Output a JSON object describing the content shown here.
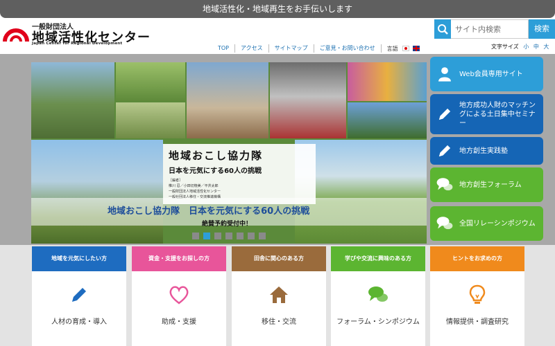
{
  "header": {
    "tagline": "地域活性化・地域再生をお手伝いします",
    "logo_small": "一般財団法人",
    "logo_main": "地域活性化センター",
    "logo_en": "Japan Center for Regional Development"
  },
  "search": {
    "placeholder": "サイト内検索",
    "button": "検索"
  },
  "nav": {
    "links": [
      "TOP",
      "アクセス",
      "サイトマップ",
      "ご意見・お問い合わせ"
    ],
    "lang_label": "言語",
    "fontsize_label": "文字サイズ",
    "fontsize_options": [
      "小",
      "中",
      "大"
    ]
  },
  "slideshow": {
    "book_title": "地域おこし協力隊",
    "book_subtitle": "日本を元気にする60人の挑戦",
    "book_meta": [
      "［編者］",
      "椎川 忍／小田切徳美／平井太郎",
      "一般財団法人地域活性化センター",
      "一般社団法人移住・交流推進機構"
    ],
    "caption": "地域おこし協力隊　日本を元気にする60人の挑戦",
    "subcaption": "絶賛予約受付中！",
    "dot_count": 7,
    "active_dot": 1
  },
  "sidenav": [
    {
      "label": "Web会員専用サイト",
      "icon": "person-icon",
      "color": "#2d9ed8"
    },
    {
      "label": "地方成功人財のマッチングによる土日集中セミナー",
      "icon": "pencil-icon",
      "color": "#1565b5"
    },
    {
      "label": "地方創生実践塾",
      "icon": "pencil-icon",
      "color": "#1565b5"
    },
    {
      "label": "地方創生フォーラム",
      "icon": "chat-icon",
      "color": "#5cb531"
    },
    {
      "label": "全国リレーシンポジウム",
      "icon": "chat-icon",
      "color": "#5cb531"
    }
  ],
  "categories": [
    {
      "head": "地域を元気にしたい方",
      "label": "人材の育成・導入",
      "icon": "pencil-icon",
      "color": "#1e6cc0",
      "icon_color": "#1e6cc0"
    },
    {
      "head": "資金・支援をお探しの方",
      "label": "助成・支援",
      "icon": "heart-icon",
      "color": "#e8559a",
      "icon_color": "#e8559a"
    },
    {
      "head": "田舎に関心のある方",
      "label": "移住・交流",
      "icon": "home-icon",
      "color": "#9a6b3c",
      "icon_color": "#9a6b3c"
    },
    {
      "head": "学びや交流に興味のある方",
      "label": "フォーラム・シンポジウム",
      "icon": "chat-icon",
      "color": "#5cb531",
      "icon_color": "#5cb531"
    },
    {
      "head": "ヒントをお求めの方",
      "label": "情報提供・調査研究",
      "icon": "lightbulb-icon",
      "color": "#f08a1c",
      "icon_color": "#f08a1c"
    }
  ]
}
